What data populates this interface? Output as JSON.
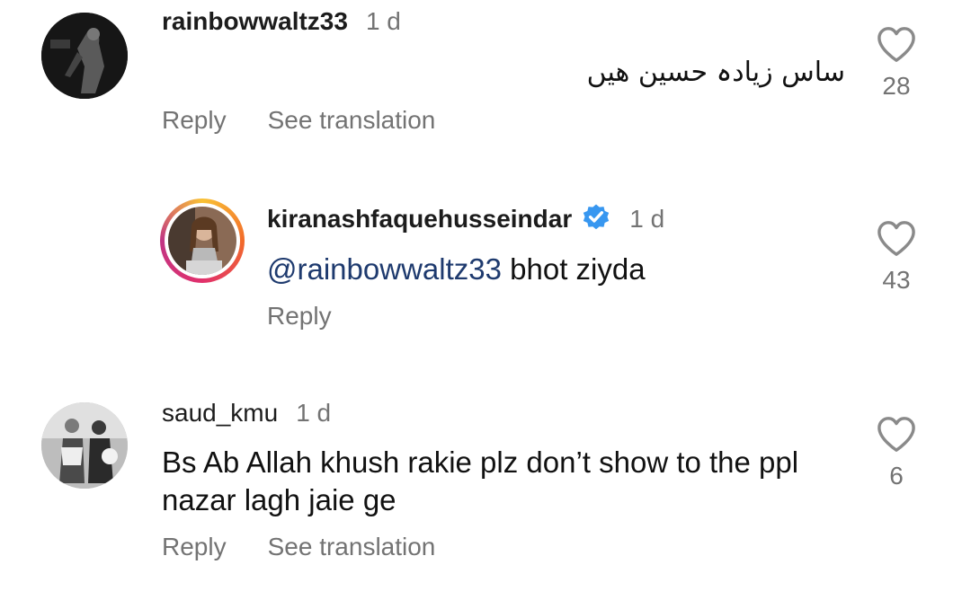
{
  "comments": [
    {
      "username": "rainbowwaltz33",
      "time": "1 d",
      "text": "ساس زیادہ حسین ھیں",
      "likes": "28",
      "reply_label": "Reply",
      "translate_label": "See translation",
      "avatar_icon": "profile-photo"
    },
    {
      "username": "kiranashfaquehusseindar",
      "verified": true,
      "time": "1 d",
      "mention": "@rainbowwaltz33",
      "text": "bhot ziyda",
      "likes": "43",
      "reply_label": "Reply",
      "avatar_icon": "profile-photo-story-ring"
    },
    {
      "username": "saud_kmu",
      "time": "1 d",
      "text_line1": "Bs Ab Allah khush rakie plz don’t show to the ppl",
      "text_line2": "nazar lagh jaie ge",
      "likes": "6",
      "reply_label": "Reply",
      "translate_label": "See translation",
      "avatar_icon": "profile-photo"
    }
  ],
  "colors": {
    "verified_badge": "#3897f0",
    "mention": "#1e3a6e",
    "secondary_text": "#737373"
  }
}
